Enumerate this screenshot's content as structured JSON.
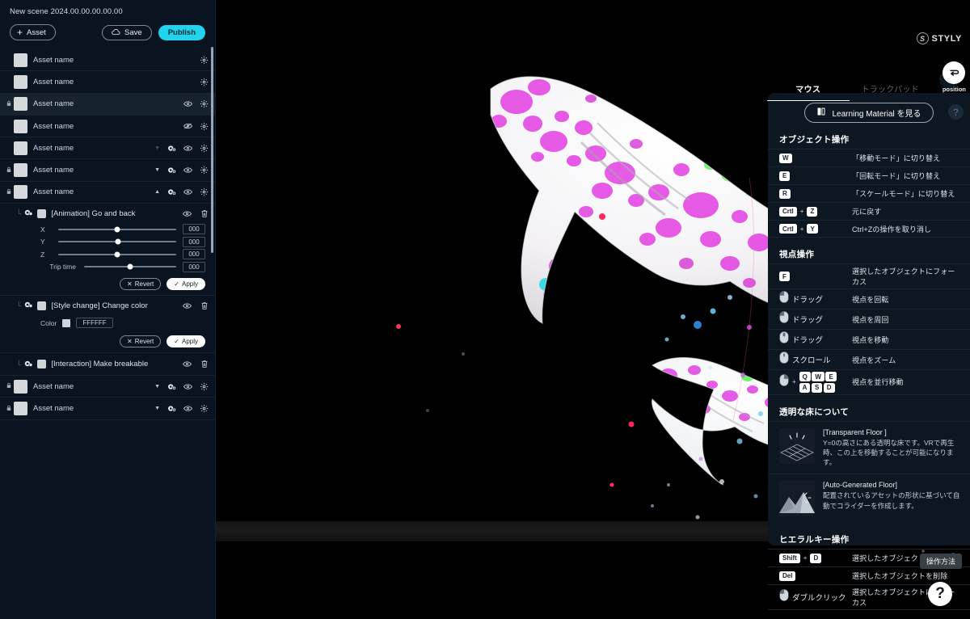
{
  "sidebar": {
    "scene_title": "New scene 2024.00.00.00.00.00",
    "add_asset_label": "Asset",
    "save_label": "Save",
    "publish_label": "Publish",
    "assets": [
      {
        "name": "Asset name",
        "locked": false,
        "selected": false,
        "has_caret": false,
        "has_module": false,
        "eye": "none"
      },
      {
        "name": "Asset name",
        "locked": false,
        "selected": false,
        "has_caret": false,
        "has_module": false,
        "eye": "none"
      },
      {
        "name": "Asset name",
        "locked": true,
        "selected": true,
        "has_caret": false,
        "has_module": false,
        "eye": "visible"
      },
      {
        "name": "Asset name",
        "locked": false,
        "selected": false,
        "has_caret": false,
        "has_module": false,
        "eye": "hidden"
      },
      {
        "name": "Asset name",
        "locked": false,
        "selected": false,
        "has_caret": "down-dim",
        "has_module": true,
        "eye": "visible"
      },
      {
        "name": "Asset name",
        "locked": true,
        "selected": false,
        "has_caret": "down",
        "has_module": true,
        "eye": "visible"
      },
      {
        "name": "Asset name",
        "locked": true,
        "selected": false,
        "has_caret": "up",
        "has_module": true,
        "eye": "visible"
      }
    ],
    "assets_tail": [
      {
        "name": "Asset name",
        "locked": true,
        "has_caret": "down",
        "has_module": true,
        "eye": "visible"
      },
      {
        "name": "Asset name",
        "locked": true,
        "has_caret": "down",
        "has_module": true,
        "eye": "visible"
      }
    ],
    "modules": [
      {
        "name": "[Animation] Go and back",
        "type": "sliders",
        "sliders": [
          {
            "label": "X",
            "value": "000",
            "pos": 50
          },
          {
            "label": "Y",
            "value": "000",
            "pos": 51
          },
          {
            "label": "Z",
            "value": "000",
            "pos": 50
          },
          {
            "label": "Trip time",
            "value": "000",
            "pos": 50
          }
        ],
        "revert_label": "Revert",
        "apply_label": "Apply"
      },
      {
        "name": "[Style change] Change color",
        "type": "color",
        "color_label": "Color",
        "color_value": "FFFFFF",
        "swatch_hex": "#cfd4d9",
        "revert_label": "Revert",
        "apply_label": "Apply"
      },
      {
        "name": "[Interaction] Make breakable",
        "type": "plain"
      }
    ]
  },
  "brand": {
    "name": "STYLY",
    "mark": "S"
  },
  "position_button": {
    "label": "position"
  },
  "right_panel": {
    "tabs": [
      {
        "label": "マウス",
        "active": true
      },
      {
        "label": "トラックパッド",
        "active": false
      }
    ],
    "learning_material_label": "Learning Material を見る",
    "help_label": "?",
    "sections": [
      {
        "title": "オブジェクト操作",
        "rows": [
          {
            "keys": [
              "W"
            ],
            "desc": "「移動モード」に切り替え"
          },
          {
            "keys": [
              "E"
            ],
            "desc": "「回転モード」に切り替え"
          },
          {
            "keys": [
              "R"
            ],
            "desc": "「スケールモード」に切り替え"
          },
          {
            "keys": [
              "Crtl",
              "+",
              "Z"
            ],
            "desc": "元に戻す"
          },
          {
            "keys": [
              "Crtl",
              "+",
              "Y"
            ],
            "desc": "Ctrl+Zの操作を取り消し"
          }
        ]
      },
      {
        "title": "視点操作",
        "rows": [
          {
            "keys": [
              "F"
            ],
            "desc": "選択したオブジェクトにフォーカス"
          },
          {
            "mouse": "left",
            "word": "ドラッグ",
            "desc": "視点を回転"
          },
          {
            "mouse": "left",
            "word": "ドラッグ",
            "desc": "視点を周回"
          },
          {
            "mouse": "middle",
            "word": "ドラッグ",
            "desc": "視点を移動"
          },
          {
            "mouse": "scroll",
            "word": "スクロール",
            "desc": "視点をズーム"
          },
          {
            "mouse": "right",
            "keypad": [
              [
                "Q",
                "W",
                "E"
              ],
              [
                "A",
                "S",
                "D"
              ]
            ],
            "desc": "視点を並行移動"
          }
        ]
      },
      {
        "title": "透明な床について",
        "cards": [
          {
            "title": "[Transparent Floor ]",
            "body": "Y=0の高さにある透明な床です。VRで再生時、この上を移動することが可能になります。",
            "icon": "transparent-floor"
          },
          {
            "title": "[Auto-Generated Floor]",
            "body": "配置されているアセットの形状に基づいて自動でコライダーを作成します。",
            "icon": "auto-generated-floor"
          }
        ]
      },
      {
        "title": "ヒエラルキー操作",
        "rows": [
          {
            "keys": [
              "Shift",
              "+",
              "D"
            ],
            "desc": "選択したオブジェクトをコピー"
          },
          {
            "keys": [
              "Del"
            ],
            "desc": "選択したオブジェクトを削除"
          },
          {
            "mouse": "left",
            "word": "ダブルクリック",
            "desc": "選択したオブジェクトにフォーカス"
          }
        ]
      }
    ]
  },
  "footer": {
    "howto_label": "操作方法",
    "help_label": "?"
  },
  "colors": {
    "accent": "#22d3ee",
    "panel_bg": "#0c1722",
    "sidebar_bg": "#0a1420",
    "viewport_bg": "#000000",
    "whale_magenta": "#e040e0",
    "whale_cyan": "#20e0e8",
    "whale_green": "#5ef05e"
  },
  "scene": {
    "objects": [
      "whale-large",
      "whale-small"
    ],
    "particles_visible": true
  }
}
